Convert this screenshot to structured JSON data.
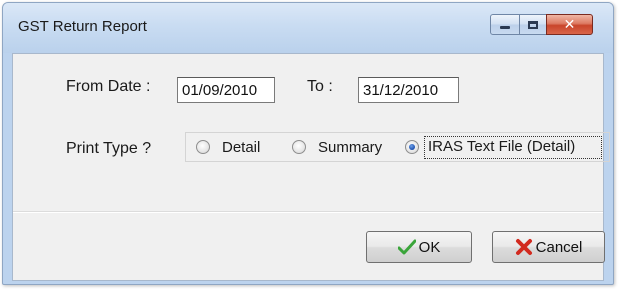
{
  "window": {
    "title": "GST Return Report"
  },
  "form": {
    "from_label": "From Date :",
    "from_value": "01/09/2010",
    "to_label": "To :",
    "to_value": "31/12/2010",
    "print_type_label": "Print Type ?",
    "options": [
      {
        "label": "Detail",
        "selected": false
      },
      {
        "label": "Summary",
        "selected": false
      },
      {
        "label": "IRAS Text File (Detail)",
        "selected": true
      }
    ]
  },
  "buttons": {
    "ok_label": "OK",
    "cancel_label": "Cancel"
  },
  "icons": {
    "ok": "checkmark-icon",
    "cancel": "red-x-icon",
    "minimize": "minimize-icon",
    "maximize": "maximize-icon",
    "close": "close-icon"
  },
  "colors": {
    "ok_check": "#3aa53a",
    "cancel_x": "#d22a1f",
    "close_button": "#c9452b"
  }
}
